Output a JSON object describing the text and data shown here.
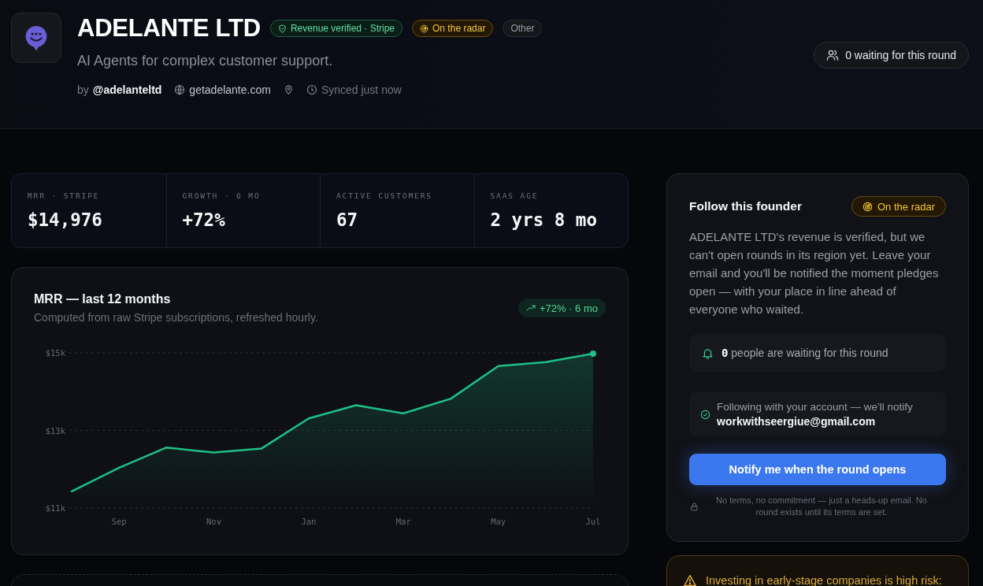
{
  "header": {
    "title": "ADELANTE LTD",
    "badges": [
      {
        "label": "Revenue verified · Stripe",
        "kind": "verified"
      },
      {
        "label": "On the radar",
        "kind": "radar"
      },
      {
        "label": "Other",
        "kind": "category"
      }
    ],
    "tagline": "AI Agents for complex customer support.",
    "author_prefix": "by",
    "author_handle": "@adelanteltd",
    "website": "getadelante.com",
    "sync_status": "Synced just now",
    "waiting_button": "0 waiting for this round"
  },
  "stats": [
    {
      "label": "MRR · STRIPE",
      "value": "$14,976"
    },
    {
      "label": "GROWTH · 6 MO",
      "value": "+72%"
    },
    {
      "label": "ACTIVE CUSTOMERS",
      "value": "67"
    },
    {
      "label": "SAAS AGE",
      "value": "2 yrs 8 mo"
    }
  ],
  "mrr_chart": {
    "title": "MRR — last 12 months",
    "subtitle": "Computed from raw Stripe subscriptions, refreshed hourly.",
    "growth_badge": "+72% · 6 mo",
    "chart_data": {
      "type": "area",
      "categories": [
        null,
        "Sep",
        null,
        "Nov",
        null,
        "Jan",
        null,
        "Mar",
        null,
        "May",
        null,
        "Jul"
      ],
      "values": [
        11430,
        12040,
        12560,
        12430,
        12530,
        13310,
        13650,
        13440,
        13820,
        14660,
        14760,
        14980
      ],
      "ylim": [
        11000,
        15000
      ],
      "yticks": [
        {
          "value": 11000,
          "label": "$11k"
        },
        {
          "value": 13000,
          "label": "$13k"
        },
        {
          "value": 15000,
          "label": "$15k"
        }
      ]
    }
  },
  "follow_card": {
    "title": "Follow this founder",
    "badge": {
      "label": "On the radar",
      "kind": "radar"
    },
    "description": "ADELANTE LTD's revenue is verified, but we can't open rounds in its region yet. Leave your email and you'll be notified the moment pledges open — with your place in line ahead of everyone who waited.",
    "waiting": "**0** people are waiting for this round",
    "following": "Following with your account — we'll notify **workwithseergiue@gmail.com**",
    "button": "Notify me when the round opens",
    "note": "No terms, no commitment — just a heads-up email. No round exists until its terms are set."
  },
  "risk_warning": {
    "text": "Investing in early-stage companies is high risk:"
  }
}
